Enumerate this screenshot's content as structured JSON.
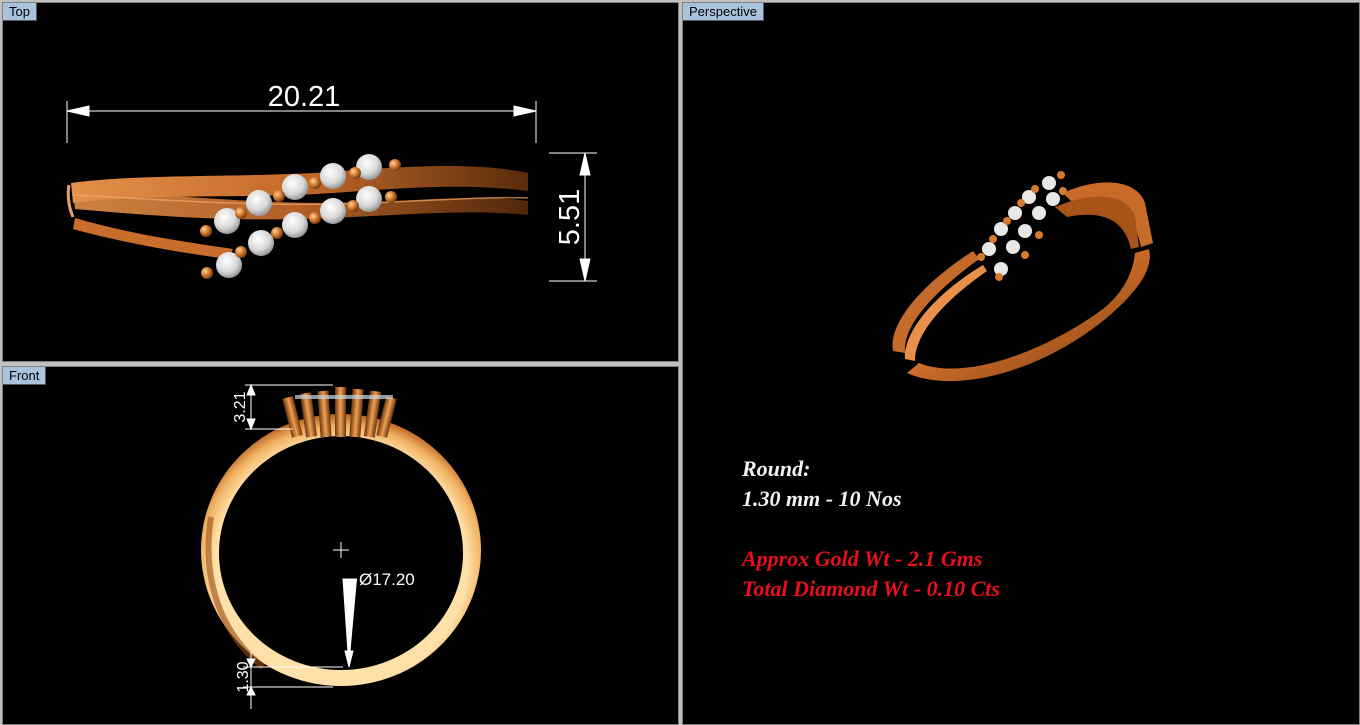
{
  "viewports": {
    "top": {
      "label": "Top",
      "dimension_width": "20.21",
      "dimension_height": "5.51"
    },
    "front": {
      "label": "Front",
      "dimension_diameter": "Ø17.20",
      "dimension_setting_height": "3.21",
      "dimension_band_thickness": "1.30"
    },
    "perspective": {
      "label": "Perspective"
    }
  },
  "specs": {
    "stone_shape": "Round:",
    "stone_detail": "1.30 mm - 10 Nos",
    "gold_weight": "Approx Gold Wt - 2.1 Gms",
    "diamond_weight": "Total Diamond Wt - 0.10 Cts"
  },
  "colors": {
    "gold": "#d9803a",
    "viewport_bg": "#000000",
    "label_bg": "#a9c3dd",
    "highlight_text": "#e8101a"
  }
}
